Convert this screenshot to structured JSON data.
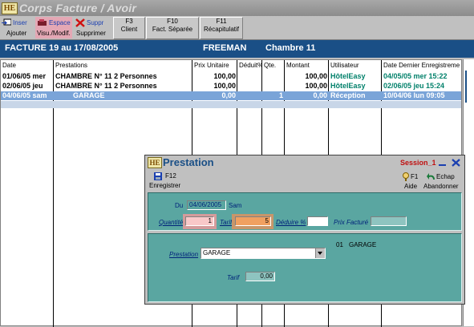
{
  "window": {
    "logo": "HE",
    "title": "Corps Facture / Avoir"
  },
  "toolbar": {
    "inserer_top": "Inser",
    "inserer_bottom": "Ajouter",
    "espace_top": "Espace",
    "espace_bottom": "Visu./Modif.",
    "suppr_top": "Suppr",
    "suppr_bottom": "Supprimer",
    "f3_key": "F3",
    "f3_label": "Client",
    "f10_key": "F10",
    "f10_label": "Fact. Séparée",
    "f11_key": "F11",
    "f11_label": "Récapitulatif"
  },
  "header": {
    "facture": "FACTURE  19  au 17/08/2005",
    "client": "FREEMAN",
    "chambre": "Chambre 11"
  },
  "table": {
    "columns": [
      "Date",
      "Prestations",
      "Prix Unitaire",
      "Déduit%",
      "Qte.",
      "Montant",
      "Utilisateur",
      "Date Dernier Enregistreme"
    ],
    "rows": [
      {
        "date": "01/06/05 mer",
        "prestation": "CHAMBRE N° 11 2 Personnes",
        "prix": "100,00",
        "deduit": "",
        "qte": "",
        "montant": "100,00",
        "user": "HôtelEasy",
        "last": "04/05/05 mer 15:22"
      },
      {
        "date": "02/06/05 jeu",
        "prestation": "CHAMBRE N° 11 2 Personnes",
        "prix": "100,00",
        "deduit": "",
        "qte": "",
        "montant": "100,00",
        "user": "HôtelEasy",
        "last": "02/06/05 jeu 15:24"
      },
      {
        "date": "04/06/05 sam",
        "prestation": "GARAGE",
        "prix": "0,00",
        "deduit": "",
        "qte": "1",
        "montant": "0,00",
        "user": "Réception",
        "last": "10/04/06 lun 09:05"
      }
    ],
    "selected_row": 2
  },
  "dialog": {
    "logo": "HE",
    "title": "Prestation",
    "session": "Session_1",
    "enregistrer_key": "F12",
    "enregistrer_label": "Enregistrer",
    "aide_key": "F1",
    "aide_label": "Aide",
    "abandonner_key": "Echap",
    "abandonner_label": "Abandonner",
    "du_label": "Du",
    "du_value": "04/06/2005",
    "du_day": "Sam",
    "quantite_label": "Quantité",
    "quantite_value": "1",
    "tarif_label": "Tarif",
    "tarif_value": "5",
    "deduire_label": "Déduire %",
    "deduire_value": "",
    "prix_facture_label": "Prix Facturé",
    "prix_facture_value": "",
    "code": "01",
    "code_name": "GARAGE",
    "prestation_label": "Prestation",
    "prestation_value": "GARAGE",
    "tarif2_label": "Tarif",
    "tarif2_value": "0,00"
  },
  "colors": {
    "header_blue": "#1a4f86",
    "selected_row": "#7aa4d8",
    "dialog_teal": "#5aa6a1",
    "user_green": "#00806a",
    "tarif_orange": "#f0a060"
  }
}
